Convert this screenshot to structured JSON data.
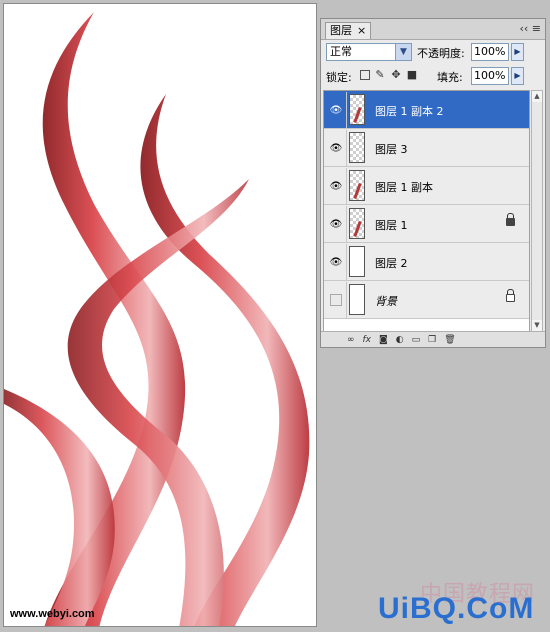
{
  "canvas": {
    "watermark": "www.webyi.com",
    "colors": {
      "stroke_light": "#f3c6c6",
      "stroke_mid": "#d9474c",
      "stroke_dark": "#8c1f22"
    }
  },
  "watermark_right": {
    "cn": "中国教程网",
    "en": "UiBQ.CoM"
  },
  "layers_panel": {
    "tab_label": "图层",
    "menu_icon": "panel-menu-icon",
    "blend_mode": "正常",
    "opacity_label": "不透明度:",
    "opacity_value": "100%",
    "lock_label": "锁定:",
    "fill_label": "填充:",
    "fill_value": "100%",
    "layers": [
      {
        "name": "图层 1 副本 2",
        "visible": true,
        "selected": true,
        "thumb": "transparent",
        "lock": ""
      },
      {
        "name": "图层 3",
        "visible": true,
        "selected": false,
        "thumb": "transparent",
        "lock": ""
      },
      {
        "name": "图层 1 副本",
        "visible": true,
        "selected": false,
        "thumb": "transparent",
        "lock": ""
      },
      {
        "name": "图层 1",
        "visible": true,
        "selected": false,
        "thumb": "transparent",
        "lock": "partial"
      },
      {
        "name": "图层 2",
        "visible": true,
        "selected": false,
        "thumb": "white",
        "lock": ""
      },
      {
        "name": "背景",
        "visible": false,
        "selected": false,
        "thumb": "white",
        "lock": "full"
      }
    ],
    "bottom_icons": [
      "link-icon",
      "fx-icon",
      "mask-icon",
      "adjustment-icon",
      "folder-icon",
      "new-layer-icon",
      "trash-icon"
    ]
  }
}
